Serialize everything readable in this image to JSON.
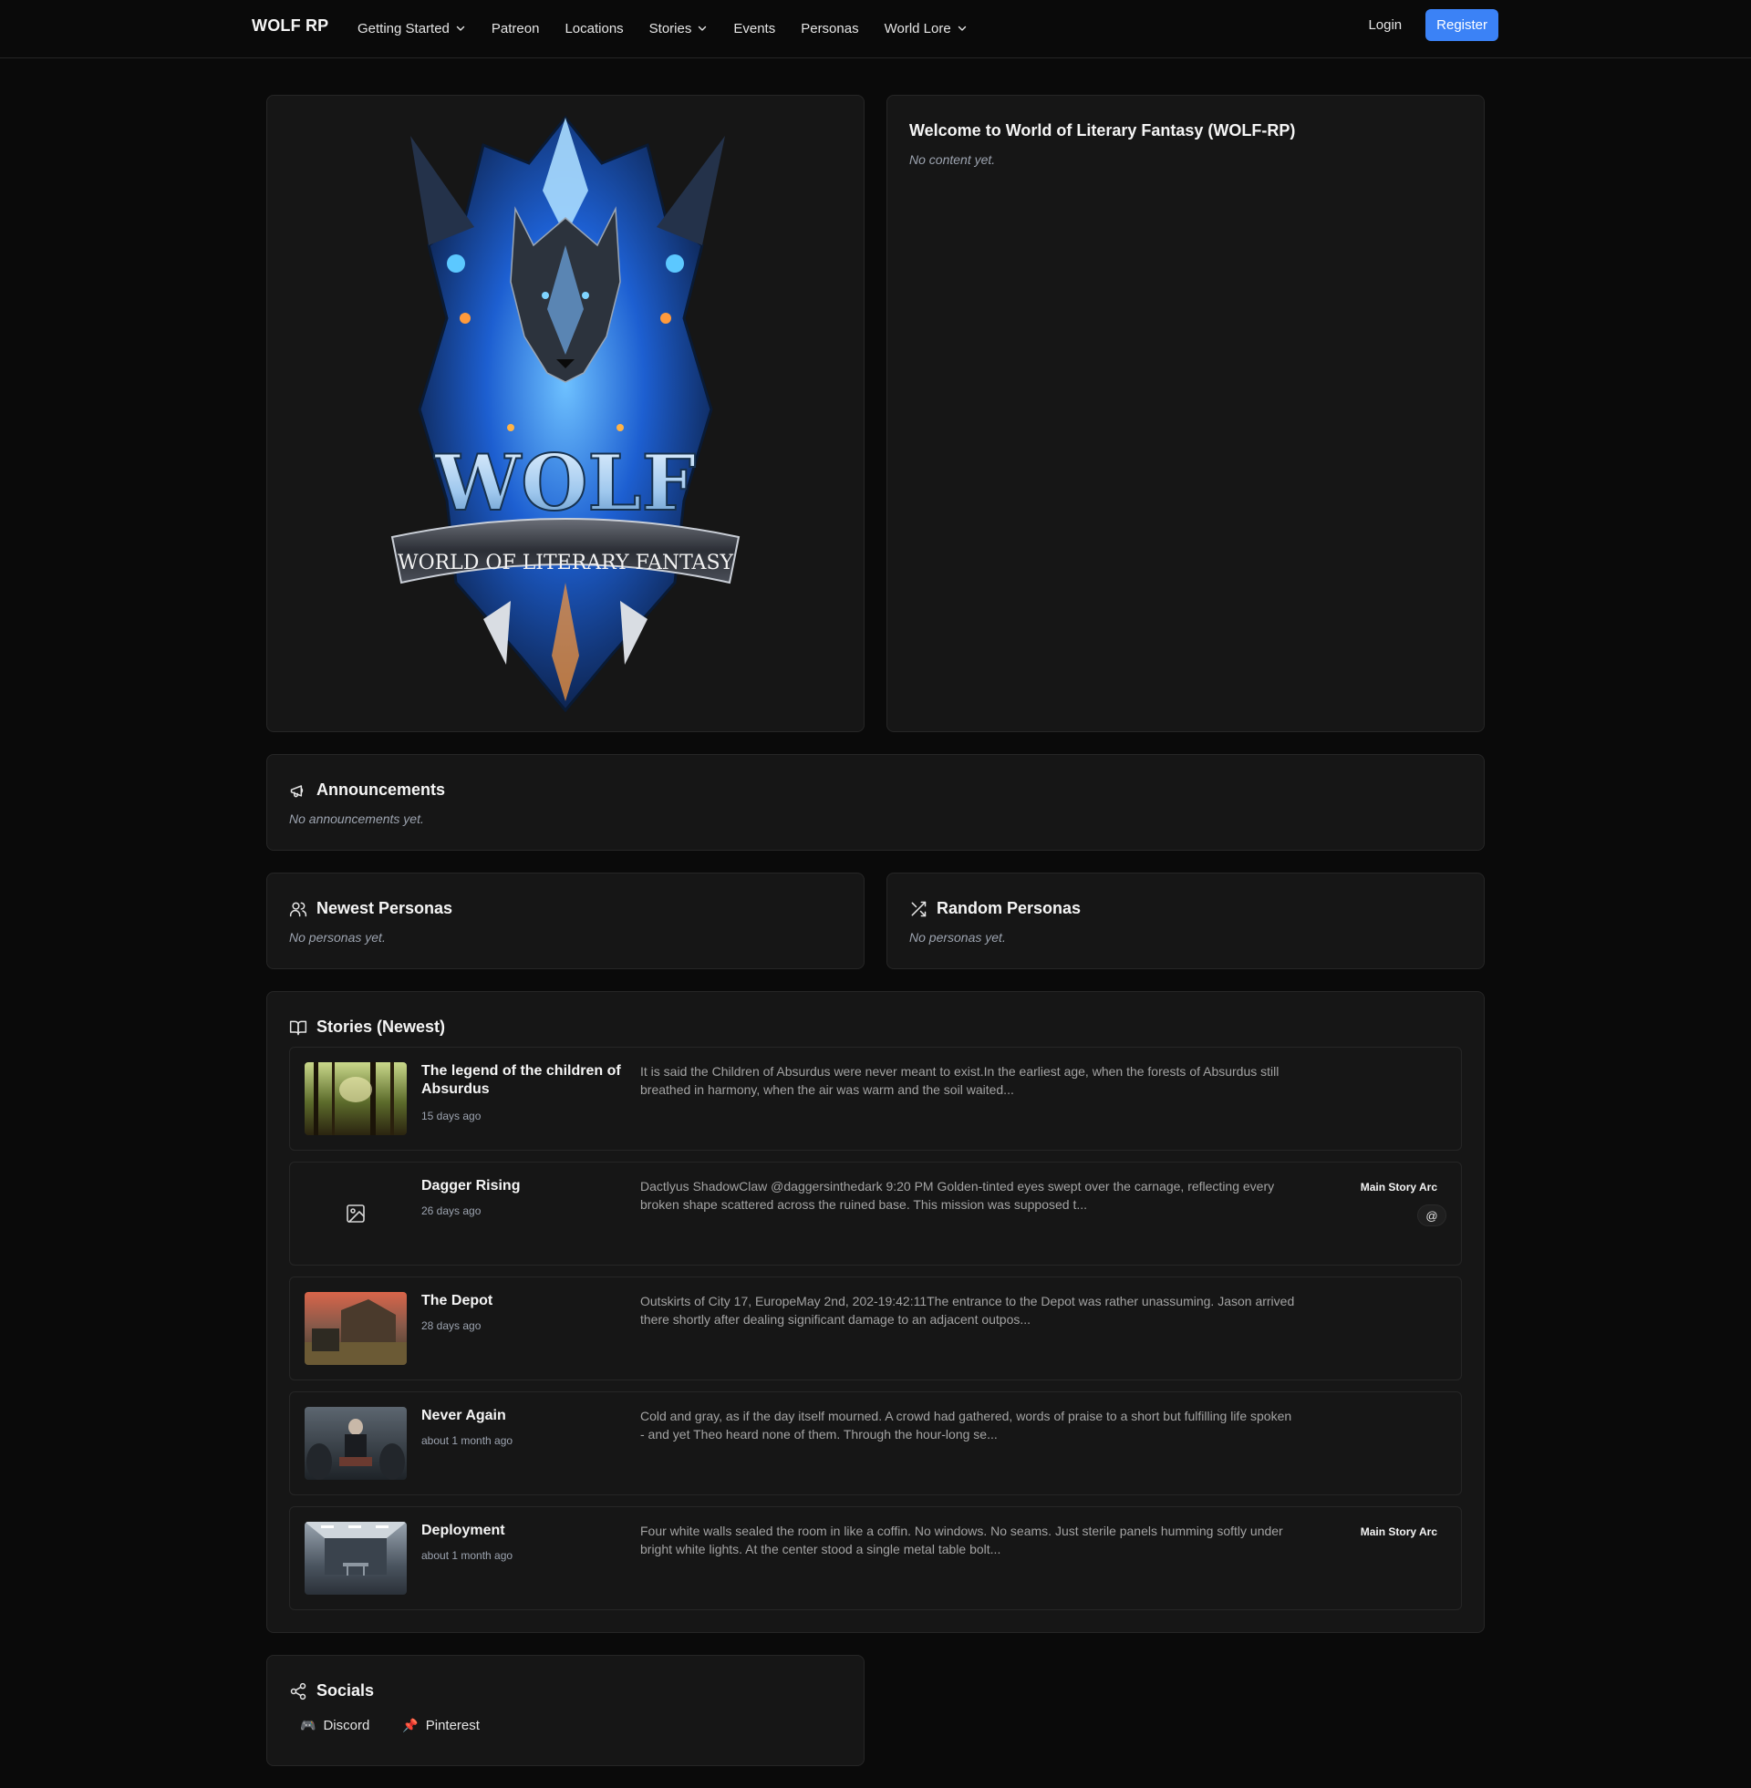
{
  "nav": {
    "brand": "WOLF RP",
    "links": [
      {
        "label": "Getting Started",
        "dropdown": true
      },
      {
        "label": "Patreon",
        "dropdown": false
      },
      {
        "label": "Locations",
        "dropdown": false
      },
      {
        "label": "Stories",
        "dropdown": true
      },
      {
        "label": "Events",
        "dropdown": false
      },
      {
        "label": "Personas",
        "dropdown": false
      },
      {
        "label": "World Lore",
        "dropdown": true
      }
    ],
    "login": "Login",
    "register": "Register"
  },
  "logo": {
    "title": "WOLF",
    "subtitle": "WORLD OF LITERARY FANTASY"
  },
  "welcome": {
    "title": "Welcome to World of Literary Fantasy (WOLF-RP)",
    "empty": "No content yet."
  },
  "announcements": {
    "title": "Announcements",
    "empty": "No announcements yet."
  },
  "newest_personas": {
    "title": "Newest Personas",
    "empty": "No personas yet."
  },
  "random_personas": {
    "title": "Random Personas",
    "empty": "No personas yet."
  },
  "stories": {
    "title": "Stories (Newest)",
    "items": [
      {
        "title": "The legend of the children of Absurdus",
        "date": "15 days ago",
        "excerpt": "It is said the Children of Absurdus were never meant to exist.In the earliest age, when the forests of Absurdus still breathed in harmony, when the air was warm and the soil waited...",
        "tag": "",
        "thumb": "forest"
      },
      {
        "title": "Dagger Rising",
        "date": "26 days ago",
        "excerpt": "Dactlyus ShadowClaw @daggersinthedark 9:20 PM Golden-tinted eyes swept over the carnage, reflecting every broken shape scattered across the ruined base. This mission was supposed t...",
        "tag": "Main Story Arc",
        "at": "@",
        "thumb": "none"
      },
      {
        "title": "The Depot",
        "date": "28 days ago",
        "excerpt": "Outskirts of City 17, EuropeMay 2nd, 202-19:42:11The entrance to the Depot was rather unassuming. Jason arrived there shortly after dealing significant damage to an adjacent outpos...",
        "tag": "",
        "thumb": "depot"
      },
      {
        "title": "Never Again",
        "date": "about 1 month ago",
        "excerpt": "Cold and gray, as if the day itself mourned. A crowd had gathered, words of praise to a short but fulfilling life spoken - and yet Theo heard none of them. Through the hour-long se...",
        "tag": "",
        "thumb": "funeral"
      },
      {
        "title": "Deployment",
        "date": "about 1 month ago",
        "excerpt": "Four white walls sealed the room in like a coffin. No windows. No seams. Just sterile panels humming softly under bright white lights. At the center stood a single metal table bolt...",
        "tag": "Main Story Arc",
        "thumb": "room"
      }
    ]
  },
  "socials": {
    "title": "Socials",
    "links": [
      {
        "label": "Discord",
        "emoji": "🎮"
      },
      {
        "label": "Pinterest",
        "emoji": "📌"
      }
    ]
  }
}
